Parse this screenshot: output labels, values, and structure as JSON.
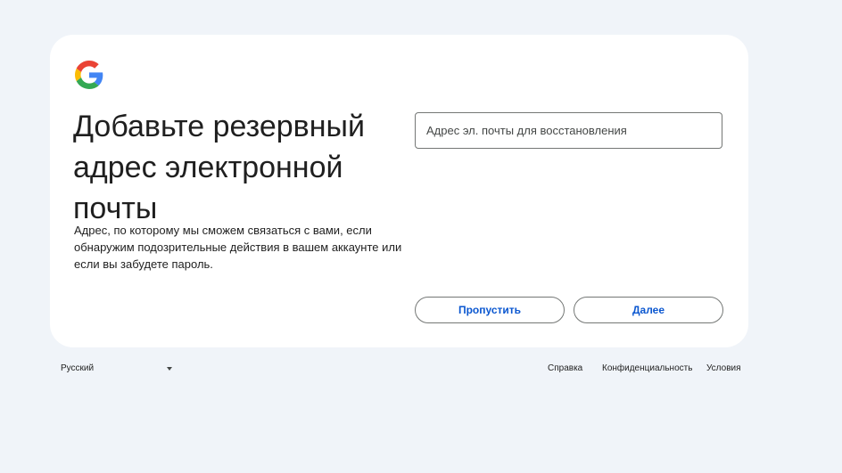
{
  "logo": {
    "icon": "google-g-icon",
    "colors": {
      "blue": "#4285F4",
      "red": "#EA4335",
      "yellow": "#FBBC05",
      "green": "#34A853"
    }
  },
  "heading": "Добавьте резервный адрес электронной почты",
  "description": "Адрес, по которому мы сможем связаться с вами, если обнаружим подозрительные действия в вашем аккаунте или если вы забудете пароль.",
  "recovery_email": {
    "placeholder": "Адрес эл. почты для восстановления",
    "value": ""
  },
  "buttons": {
    "skip": "Пропустить",
    "next": "Далее"
  },
  "footer": {
    "language": "Русский",
    "links": {
      "help": "Справка",
      "privacy": "Конфиденциальность",
      "terms": "Условия"
    }
  },
  "colors": {
    "page_background": "#f0f4f9",
    "card_background": "#ffffff",
    "accent": "#0b57d0",
    "border": "#747775"
  }
}
